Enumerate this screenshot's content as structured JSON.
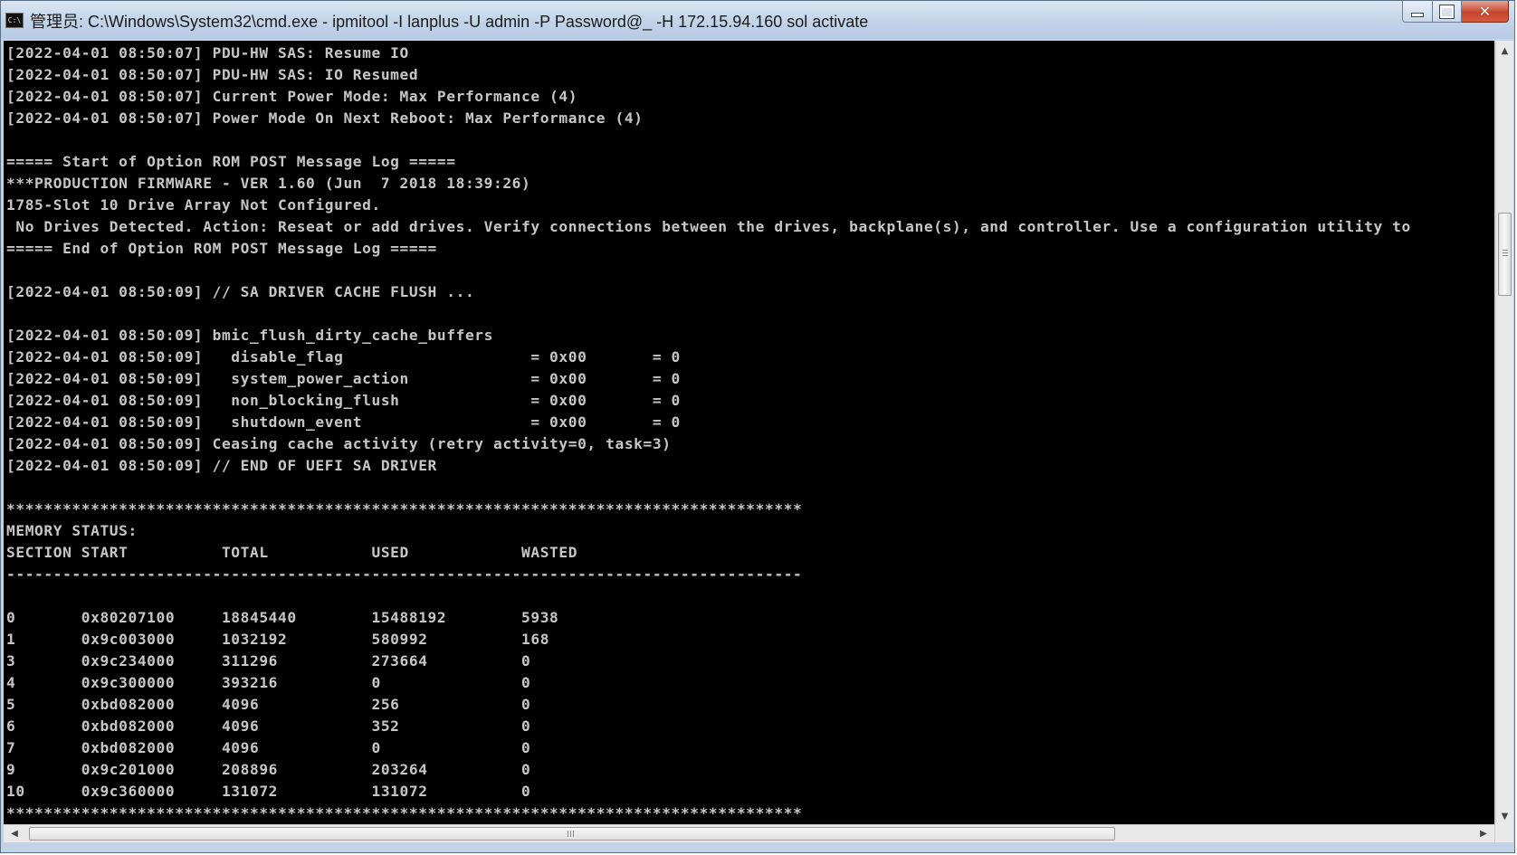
{
  "window": {
    "title": "管理员: C:\\Windows\\System32\\cmd.exe - ipmitool  -I lanplus -U admin -P Password@_ -H 172.15.94.160 sol activate",
    "icon_label": "C:\\",
    "buttons": {
      "minimize": "minimize",
      "maximize": "maximize",
      "close_label": "✕"
    }
  },
  "console": {
    "lines": [
      "[2022-04-01 08:50:07] PDU-HW SAS: Resume IO",
      "[2022-04-01 08:50:07] PDU-HW SAS: IO Resumed",
      "[2022-04-01 08:50:07] Current Power Mode: Max Performance (4)",
      "[2022-04-01 08:50:07] Power Mode On Next Reboot: Max Performance (4)",
      "",
      "===== Start of Option ROM POST Message Log =====",
      "***PRODUCTION FIRMWARE - VER 1.60 (Jun  7 2018 18:39:26)",
      "1785-Slot 10 Drive Array Not Configured.",
      " No Drives Detected. Action: Reseat or add drives. Verify connections between the drives, backplane(s), and controller. Use a configuration utility to",
      "===== End of Option ROM POST Message Log =====",
      "",
      "[2022-04-01 08:50:09] // SA DRIVER CACHE FLUSH ...",
      "",
      "[2022-04-01 08:50:09] bmic_flush_dirty_cache_buffers",
      "[2022-04-01 08:50:09]   disable_flag                    = 0x00       = 0",
      "[2022-04-01 08:50:09]   system_power_action             = 0x00       = 0",
      "[2022-04-01 08:50:09]   non_blocking_flush              = 0x00       = 0",
      "[2022-04-01 08:50:09]   shutdown_event                  = 0x00       = 0",
      "[2022-04-01 08:50:09] Ceasing cache activity (retry activity=0, task=3)",
      "[2022-04-01 08:50:09] // END OF UEFI SA DRIVER",
      "",
      "*************************************************************************************",
      "MEMORY STATUS:",
      "SECTION START          TOTAL           USED            WASTED",
      "-------------------------------------------------------------------------------------",
      "",
      "0       0x80207100     18845440        15488192        5938",
      "1       0x9c003000     1032192         580992          168",
      "3       0x9c234000     311296          273664          0",
      "4       0x9c300000     393216          0               0",
      "5       0xbd082000     4096            256             0",
      "6       0xbd082000     4096            352             0",
      "7       0xbd082000     4096            0               0",
      "9       0x9c201000     208896          203264          0",
      "10      0x9c360000     131072          131072          0",
      "*************************************************************************************",
      "",
      "_"
    ]
  },
  "scrollbars": {
    "up": "▲",
    "down": "▼",
    "left": "◀",
    "right": "▶"
  }
}
